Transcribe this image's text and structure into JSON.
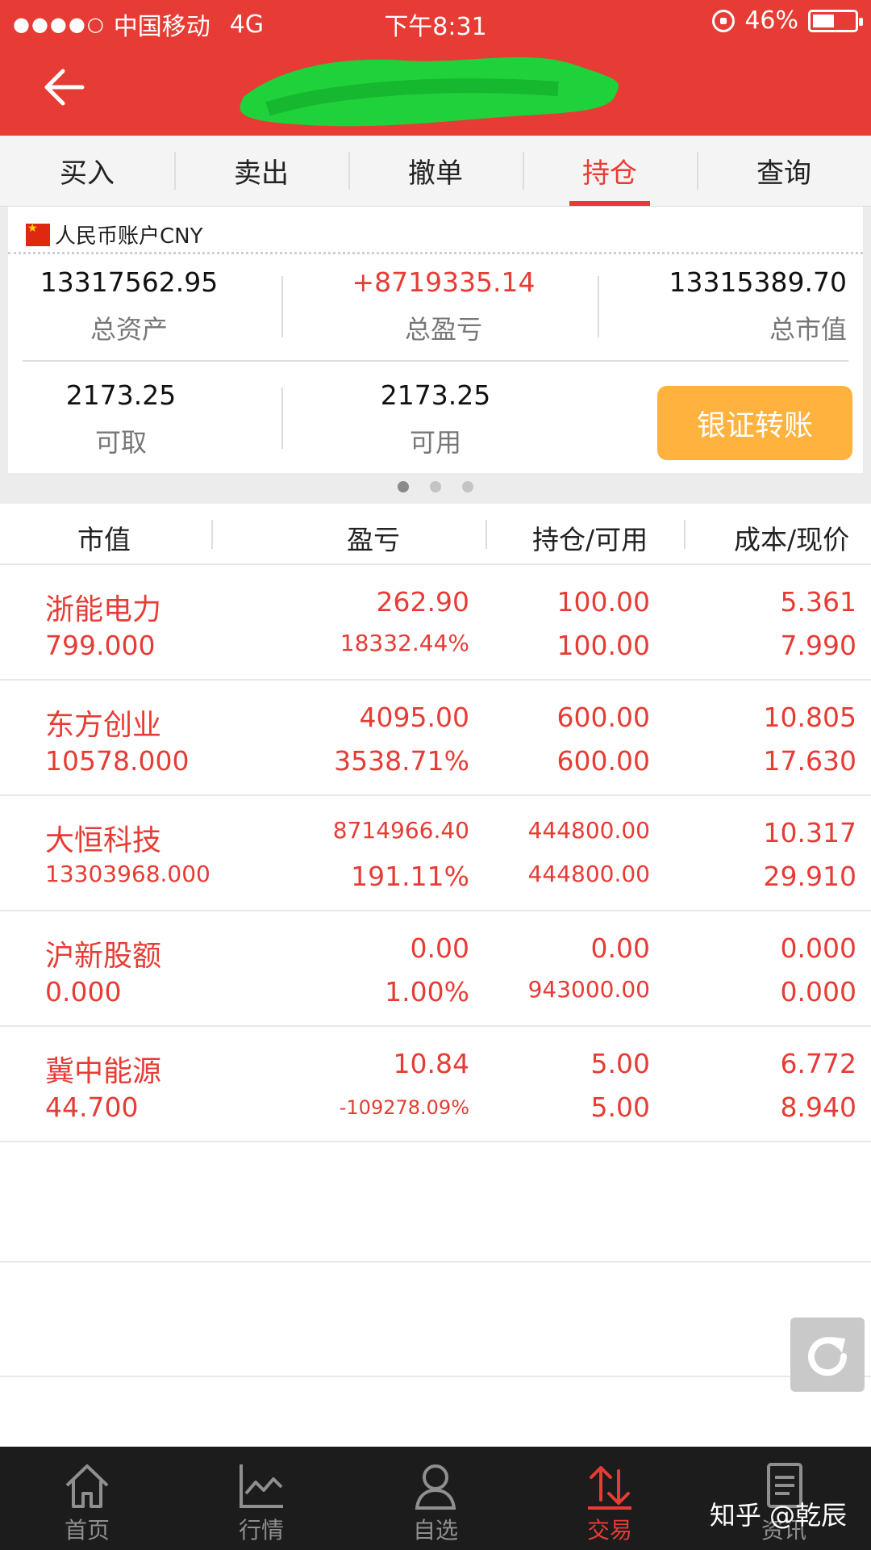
{
  "status_bar": {
    "carrier": "中国移动",
    "network": "4G",
    "time": "下午8:31",
    "battery": "46%",
    "battery_level": 0.46
  },
  "tabs": [
    {
      "label": "买入"
    },
    {
      "label": "卖出"
    },
    {
      "label": "撤单"
    },
    {
      "label": "持仓",
      "active": true
    },
    {
      "label": "查询"
    }
  ],
  "account": {
    "name": "人民币账户CNY",
    "total_assets": "13317562.95",
    "total_assets_label": "总资产",
    "total_pl": "+8719335.14",
    "total_pl_label": "总盈亏",
    "market_value": "13315389.70",
    "market_value_label": "总市值",
    "withdrawable": "2173.25",
    "withdrawable_label": "可取",
    "available": "2173.25",
    "available_label": "可用",
    "transfer_button": "银证转账"
  },
  "table": {
    "headers": [
      "市值",
      "盈亏",
      "持仓/可用",
      "成本/现价"
    ],
    "rows": [
      {
        "name": "浙能电力",
        "market_value": "799.000",
        "pl": "262.90",
        "pl_pct": "18332.44%",
        "position": "100.00",
        "available": "100.00",
        "cost": "5.361",
        "price": "7.990"
      },
      {
        "name": "东方创业",
        "market_value": "10578.000",
        "pl": "4095.00",
        "pl_pct": "3538.71%",
        "position": "600.00",
        "available": "600.00",
        "cost": "10.805",
        "price": "17.630"
      },
      {
        "name": "大恒科技",
        "market_value": "13303968.000",
        "pl": "8714966.40",
        "pl_pct": "191.11%",
        "position": "444800.00",
        "available": "444800.00",
        "cost": "10.317",
        "price": "29.910"
      },
      {
        "name": "沪新股额",
        "market_value": "0.000",
        "pl": "0.00",
        "pl_pct": "1.00%",
        "position": "0.00",
        "available": "943000.00",
        "cost": "0.000",
        "price": "0.000"
      },
      {
        "name": "冀中能源",
        "market_value": "44.700",
        "pl": "10.84",
        "pl_pct": "-109278.09%",
        "position": "5.00",
        "available": "5.00",
        "cost": "6.772",
        "price": "8.940"
      }
    ]
  },
  "nav": [
    {
      "label": "首页",
      "icon": "home-icon"
    },
    {
      "label": "行情",
      "icon": "chart-icon"
    },
    {
      "label": "自选",
      "icon": "user-icon"
    },
    {
      "label": "交易",
      "icon": "trade-icon",
      "active": true
    },
    {
      "label": "资讯",
      "icon": "news-icon"
    }
  ],
  "watermark": "知乎 @乾辰",
  "colors": {
    "accent": "#e63c35",
    "button": "#ffb23d",
    "nav_bg": "#1c1c1c"
  }
}
